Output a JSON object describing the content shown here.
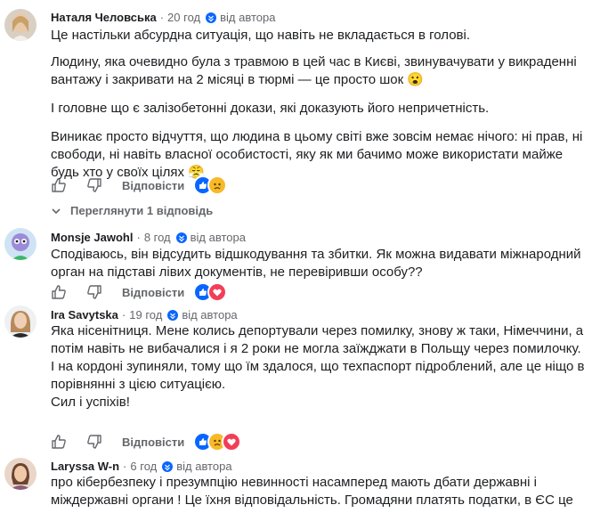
{
  "author_badge": "від автора",
  "reply_label": "Відповісти",
  "view_replies": "Переглянути 1 відповідь",
  "comments": [
    {
      "author": "Наталя Человська",
      "time": "20 год",
      "paragraphs": [
        "Це настільки абсурдна ситуація, що навіть не вкладається в голові.",
        "Людину, яка очевидно була з травмою в цей час в Києві, звинувачувати у викраденні вантажу і закривати на 2 місяці в тюрмі — це просто шок 😮",
        "І головне що є залізобетонні докази, які доказують його непричетність.",
        "Виникає просто відчуття, що людина в цьому світі вже зовсім немає нічого: ні прав, ні свободи, ні навіть власної особистості, яку як ми бачимо може використати майже будь хто у своїх цілях 😤"
      ]
    },
    {
      "author": "Monsje Jawohl",
      "time": "8 год",
      "paragraphs": [
        "Сподіваюсь, він відсудить відшкодування та збитки. Як можна видавати міжнародний орган на підставі лівих документів, не перевіривши особу??"
      ]
    },
    {
      "author": "Ira Savytska",
      "time": "19 год",
      "paragraphs": [
        "Яка нісенітниця. Мене колись депортували через помилку, знову ж таки, Німеччини, а потім навіть не вибачалися і я 2 роки не могла заїжджати в Польщу через помилочку.",
        "І на кордоні зупиняли, тому що їм здалося, що техпаспорт підроблений, але це ніщо в порівнянні з цією ситуацією.",
        "Сил і успіхів!"
      ]
    },
    {
      "author": "Laryssa W-n",
      "time": "6 год",
      "paragraphs": [
        "про кібербезпеку і презумпцію невинності насамперед мають дбати державні і міждержавні органи ! Це їхня відповідальність. Громадяни платять податки, в ЄС це"
      ]
    }
  ]
}
